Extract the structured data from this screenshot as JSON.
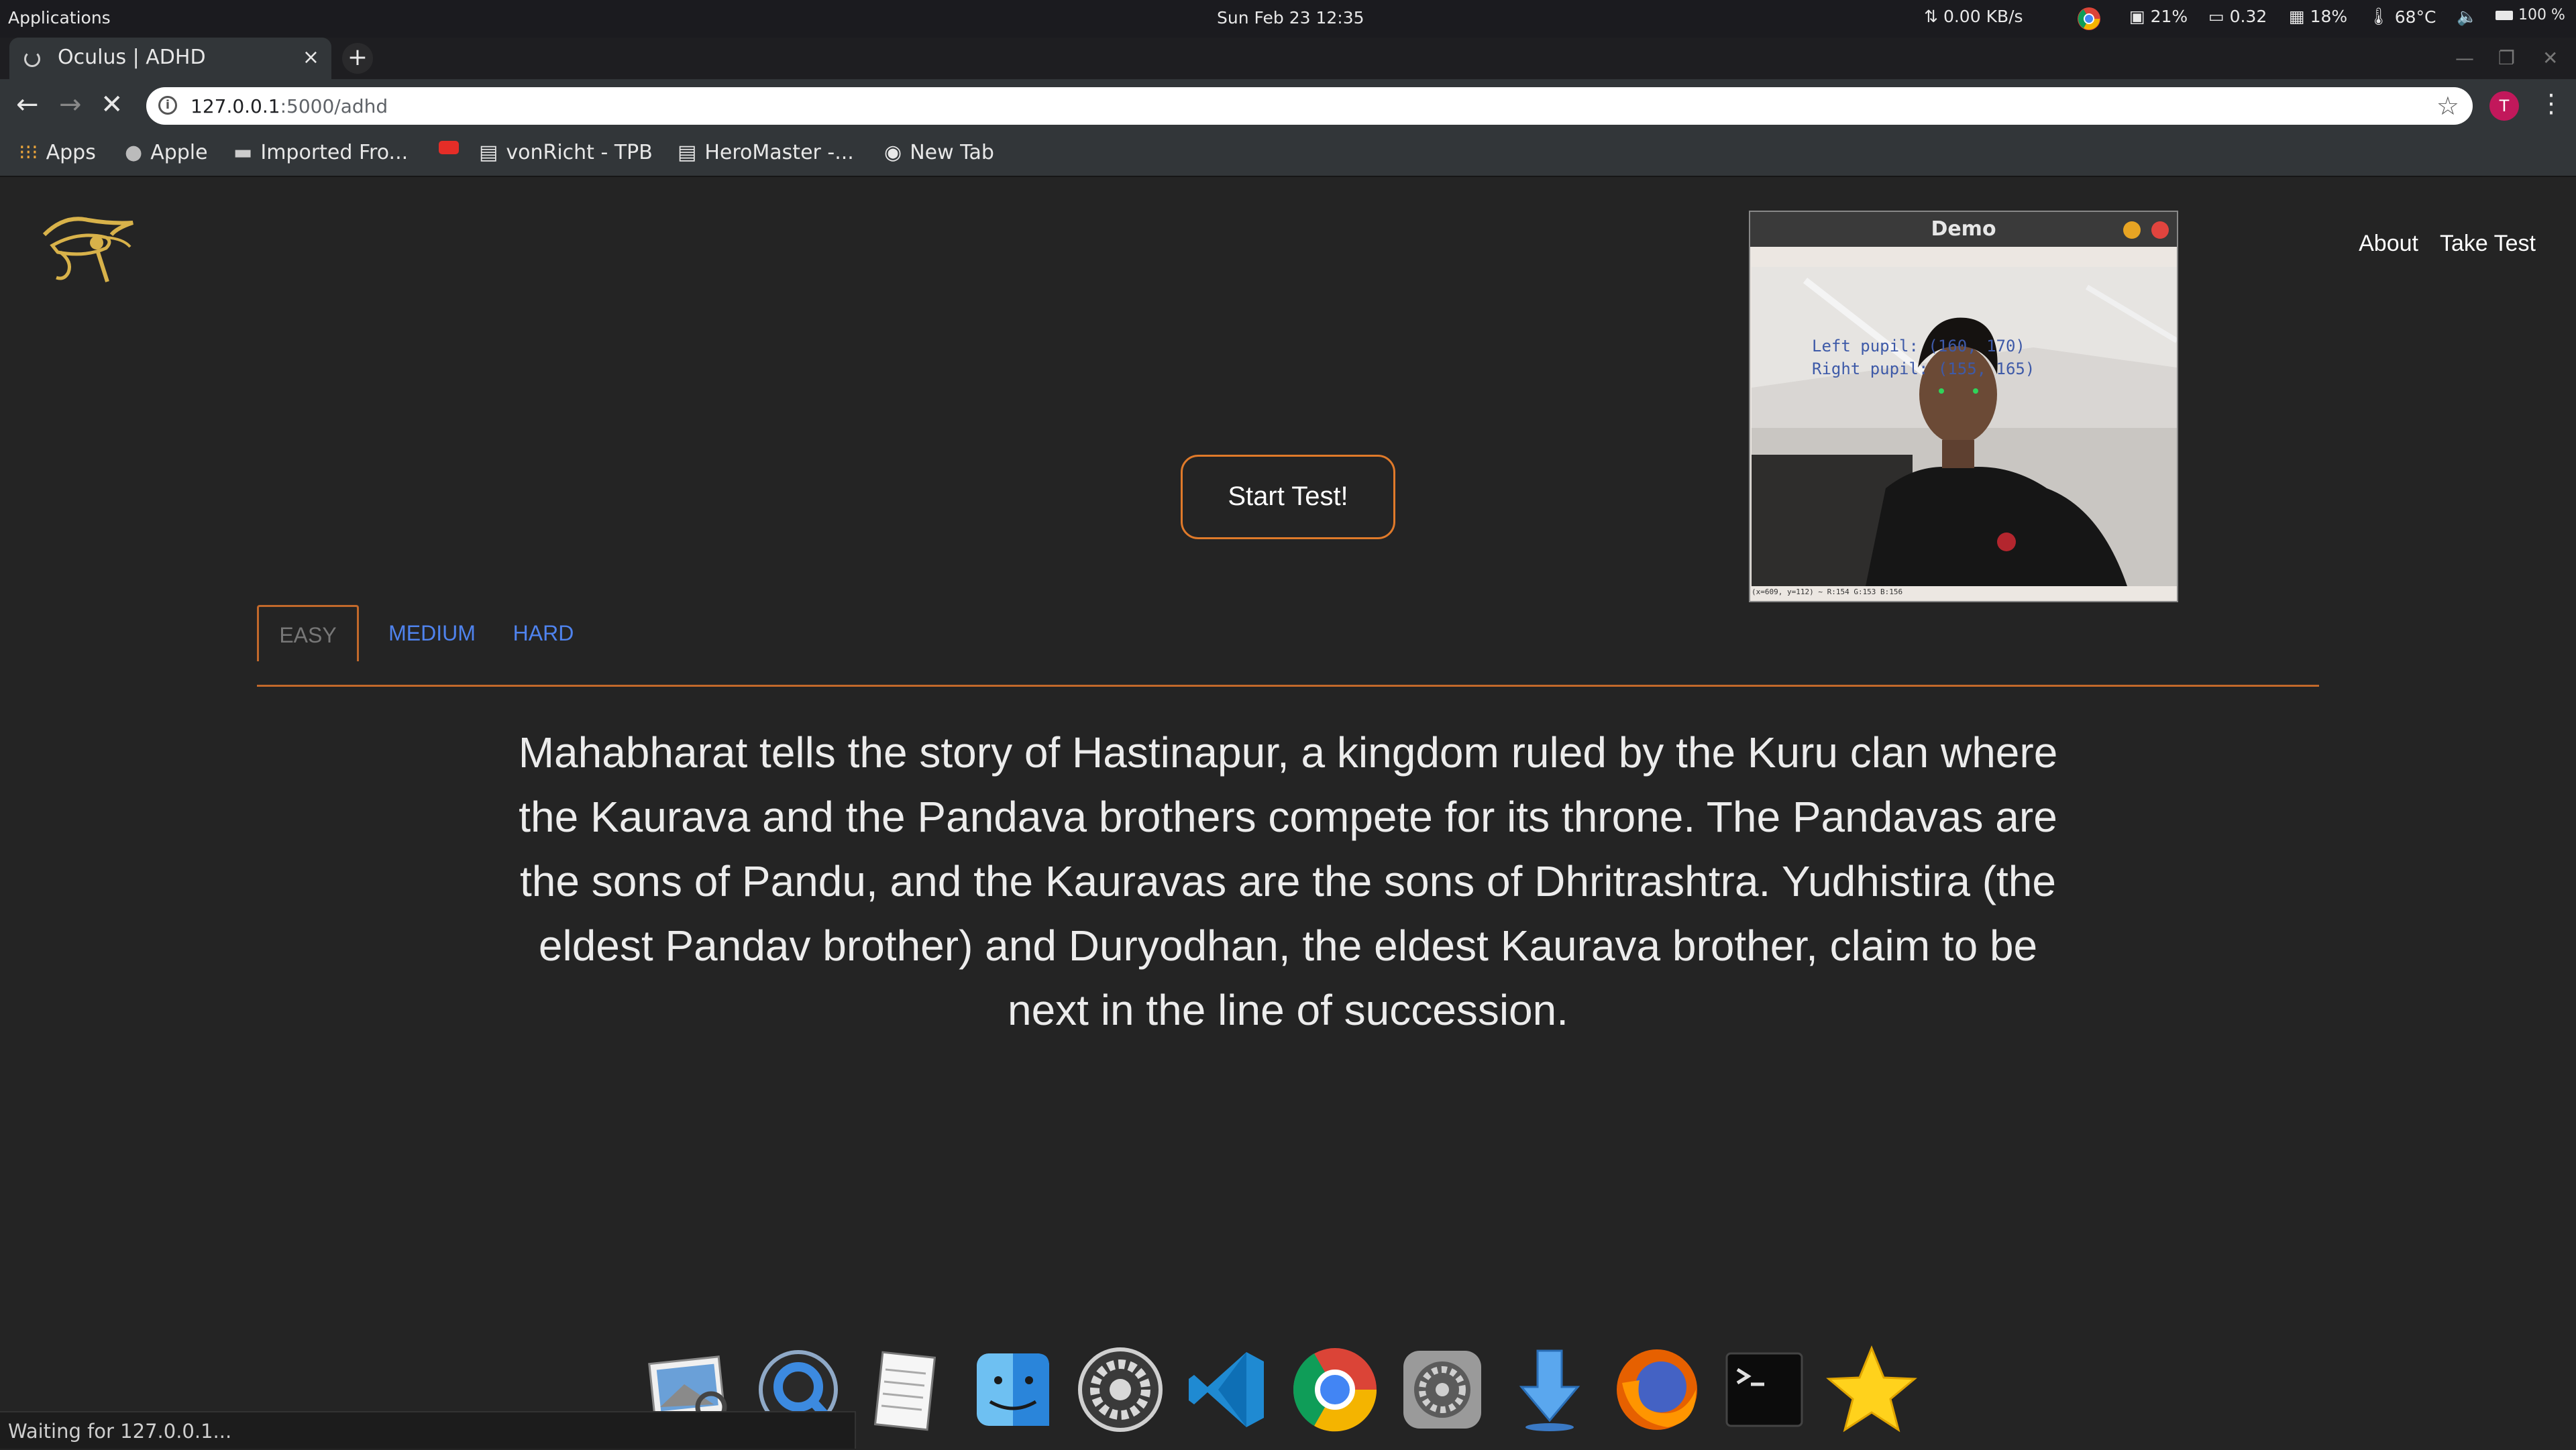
{
  "system_panel": {
    "applications_label": "Applications",
    "clock": "Sun Feb 23  12:35",
    "net_speed": "0.00 KB/s",
    "cpu": "21%",
    "load": "0.32",
    "mem": "18%",
    "temp": "68°C",
    "battery": "100 %"
  },
  "browser": {
    "tab_title": "Oculus | ADHD",
    "tab_close": "×",
    "new_tab": "+",
    "url_host": "127.0.0.1",
    "url_rest": ":5000/adhd",
    "profile_initial": "T",
    "bookmarks": [
      {
        "label": "Apps",
        "icon": "apps-grid-icon"
      },
      {
        "label": "Apple",
        "icon": "apple-icon"
      },
      {
        "label": "Imported Fro...",
        "icon": "folder-icon"
      },
      {
        "label": "",
        "icon": "youtube-icon"
      },
      {
        "label": "vonRicht - TPB",
        "icon": "page-icon"
      },
      {
        "label": "HeroMaster -...",
        "icon": "page-icon"
      },
      {
        "label": "New Tab",
        "icon": "globe-icon"
      }
    ],
    "status_text": "Waiting for 127.0.0.1..."
  },
  "page": {
    "nav": {
      "about": "About",
      "take_test": "Take Test"
    },
    "start_button": "Start Test!",
    "levels": [
      {
        "label": "EASY",
        "active": true
      },
      {
        "label": "MEDIUM",
        "active": false
      },
      {
        "label": "HARD",
        "active": false
      }
    ],
    "passage": "Mahabharat tells the story of Hastinapur, a kingdom ruled by the Kuru clan where the Kaurava and the Pandava brothers compete for its throne. The Pandavas are the sons of Pandu, and the Kauravas are the sons of Dhritrashtra. Yudhistira (the eldest Pandav brother) and Duryodhan, the eldest Kaurava brother, claim to be next in the line of succession."
  },
  "demo_window": {
    "title": "Demo",
    "left_pupil": "Left pupil:  (160, 170)",
    "right_pupil": "Right pupil: (155, 165)",
    "status": "(x=609, y=112) ~ R:154 G:153 B:156"
  },
  "dock": [
    "image-viewer-icon",
    "quicktime-icon",
    "text-editor-icon",
    "finder-icon",
    "system-settings-icon",
    "vscode-icon",
    "chrome-icon",
    "preferences-icon",
    "downloads-icon",
    "firefox-icon",
    "terminal-icon",
    "favorites-star-icon"
  ],
  "colors": {
    "accent": "#c2692b",
    "link": "#4f83ee",
    "page_bg": "#242424"
  }
}
